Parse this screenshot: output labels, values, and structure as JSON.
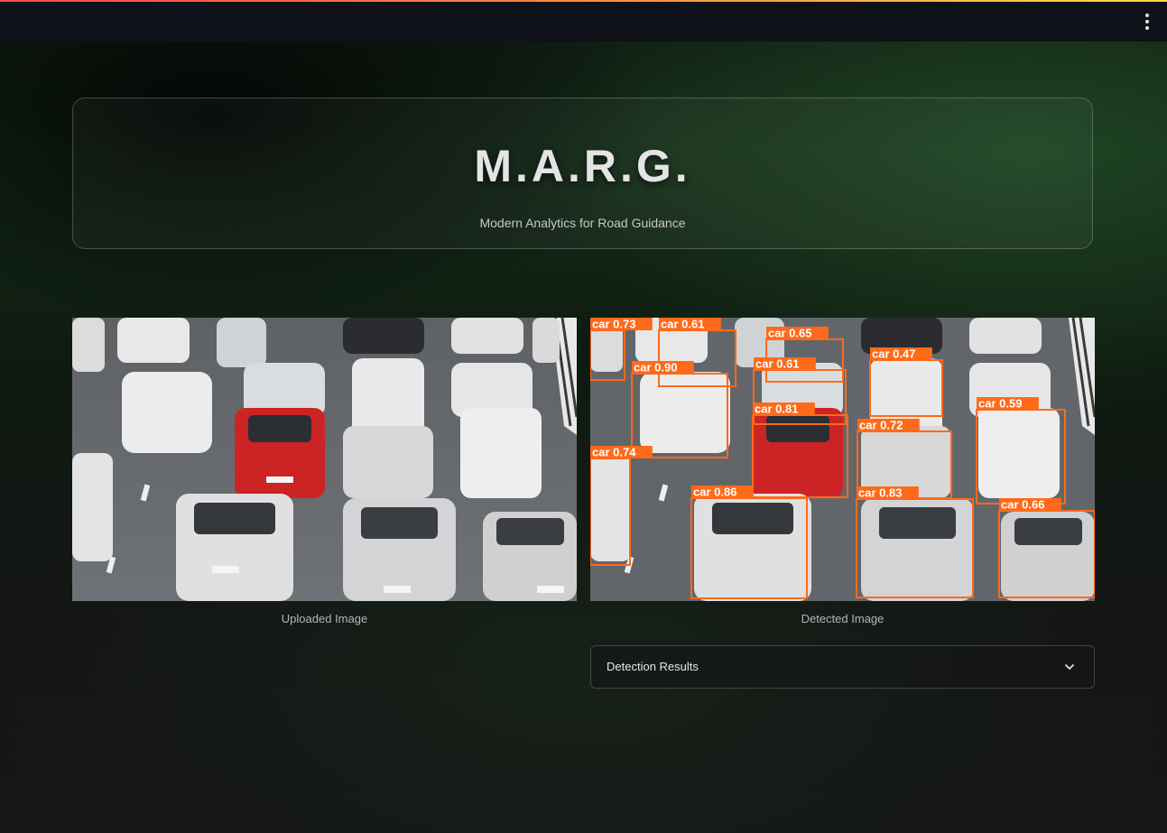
{
  "app": {
    "title": "M.A.R.G.",
    "subtitle": "Modern Analytics for Road Guidance"
  },
  "header": {
    "menu_icon": "kebab-menu-icon"
  },
  "images": {
    "uploaded_caption": "Uploaded Image",
    "detected_caption": "Detected Image"
  },
  "detections": [
    {
      "label": "car 0.73"
    },
    {
      "label": "car 0.61"
    },
    {
      "label": "car 0.65"
    },
    {
      "label": "car 0.90"
    },
    {
      "label": "car 0.61"
    },
    {
      "label": "car 0.47"
    },
    {
      "label": "car 0.81"
    },
    {
      "label": "car 0.59"
    },
    {
      "label": "car 0.72"
    },
    {
      "label": "car 0.74"
    },
    {
      "label": "car 0.86"
    },
    {
      "label": "car 0.83"
    },
    {
      "label": "car 0.66"
    }
  ],
  "expander": {
    "label": "Detection Results",
    "icon": "chevron-down-icon"
  },
  "colors": {
    "accent_gradient_start": "#ff4b4b",
    "accent_gradient_end": "#ffd84b",
    "detection_box": "#ff6a1a"
  }
}
